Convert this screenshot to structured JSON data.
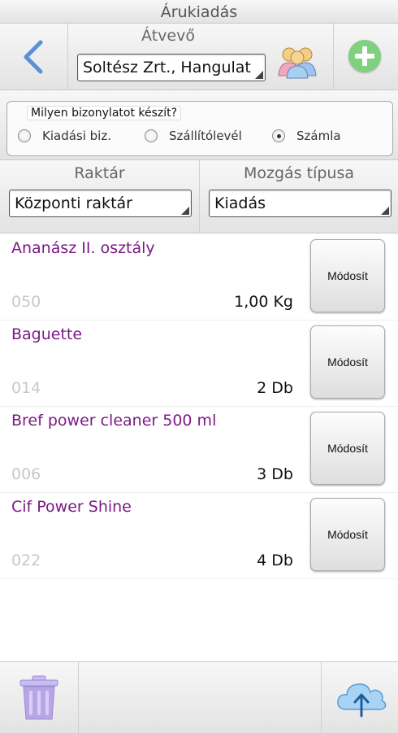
{
  "app": {
    "title": "Árukiadás"
  },
  "header": {
    "recipient_label": "Átvevő",
    "recipient_value": "Soltész Zrt., Hangulat"
  },
  "document_type": {
    "question": "Milyen bizonylatot készít?",
    "options": [
      {
        "label": "Kiadási biz.",
        "selected": false
      },
      {
        "label": "Szállítólevél",
        "selected": false
      },
      {
        "label": "Számla",
        "selected": true
      }
    ]
  },
  "warehouse": {
    "label": "Raktár",
    "value": "Központi raktár"
  },
  "movement": {
    "label": "Mozgás típusa",
    "value": "Kiadás"
  },
  "items": [
    {
      "name": "Ananász II. osztály",
      "code": "050",
      "quantity": "1,00 Kg",
      "button": "Módosít"
    },
    {
      "name": "Baguette",
      "code": "014",
      "quantity": "2 Db",
      "button": "Módosít"
    },
    {
      "name": "Bref power cleaner 500 ml",
      "code": "006",
      "quantity": "3 Db",
      "button": "Módosít"
    },
    {
      "name": "Cif Power Shine",
      "code": "022",
      "quantity": "4 Db",
      "button": "Módosít"
    }
  ],
  "colors": {
    "item_name": "#7b1a85",
    "accent_blue": "#5b8fd8",
    "add_green": "#7fd07f",
    "trash": "#b7a6e6"
  },
  "icons": [
    "back-arrow-icon",
    "people-icon",
    "add-icon",
    "trash-icon",
    "cloud-upload-icon"
  ]
}
